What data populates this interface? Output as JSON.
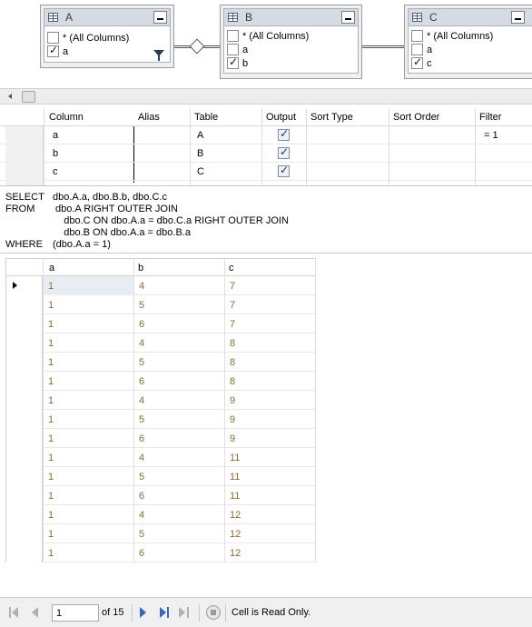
{
  "diagram": {
    "tables": [
      {
        "name": "A",
        "rows": [
          {
            "label": "* (All Columns)",
            "checked": false
          },
          {
            "label": "a",
            "checked": true
          }
        ],
        "has_filter": true
      },
      {
        "name": "B",
        "rows": [
          {
            "label": "* (All Columns)",
            "checked": false
          },
          {
            "label": "a",
            "checked": false
          },
          {
            "label": "b",
            "checked": true
          }
        ]
      },
      {
        "name": "C",
        "rows": [
          {
            "label": "* (All Columns)",
            "checked": false
          },
          {
            "label": "a",
            "checked": false
          },
          {
            "label": "c",
            "checked": true
          }
        ]
      }
    ]
  },
  "criteria": {
    "headers": [
      "Column",
      "Alias",
      "Table",
      "Output",
      "Sort Type",
      "Sort Order",
      "Filter"
    ],
    "rows": [
      {
        "column": "a",
        "alias": "",
        "table": "A",
        "output": true,
        "sort_type": "",
        "sort_order": "",
        "filter": "= 1"
      },
      {
        "column": "b",
        "alias": "",
        "table": "B",
        "output": true,
        "sort_type": "",
        "sort_order": "",
        "filter": ""
      },
      {
        "column": "c",
        "alias": "",
        "table": "C",
        "output": true,
        "sort_type": "",
        "sort_order": "",
        "filter": ""
      }
    ]
  },
  "sql": {
    "lines": [
      {
        "keyword": "SELECT",
        "text": "dbo.A.a, dbo.B.b, dbo.C.c"
      },
      {
        "keyword": "FROM",
        "text": " dbo.A RIGHT OUTER JOIN"
      },
      {
        "keyword": "",
        "text": "    dbo.C ON dbo.A.a = dbo.C.a RIGHT OUTER JOIN"
      },
      {
        "keyword": "",
        "text": "    dbo.B ON dbo.A.a = dbo.B.a"
      },
      {
        "keyword": "WHERE",
        "text": "(dbo.A.a = 1)"
      }
    ]
  },
  "results": {
    "headers": [
      "a",
      "b",
      "c"
    ],
    "rows": [
      [
        "1",
        "4",
        "7"
      ],
      [
        "1",
        "5",
        "7"
      ],
      [
        "1",
        "6",
        "7"
      ],
      [
        "1",
        "4",
        "8"
      ],
      [
        "1",
        "5",
        "8"
      ],
      [
        "1",
        "6",
        "8"
      ],
      [
        "1",
        "4",
        "9"
      ],
      [
        "1",
        "5",
        "9"
      ],
      [
        "1",
        "6",
        "9"
      ],
      [
        "1",
        "4",
        "11"
      ],
      [
        "1",
        "5",
        "11"
      ],
      [
        "1",
        "6",
        "11"
      ],
      [
        "1",
        "4",
        "12"
      ],
      [
        "1",
        "5",
        "12"
      ],
      [
        "1",
        "6",
        "12"
      ]
    ],
    "current_row": 0
  },
  "navbar": {
    "page_value": "1",
    "of_text": "of 15",
    "status": "Cell is Read Only."
  },
  "colors": {
    "result_text": "#8a6a3a",
    "nav_accent": "#3a66b8"
  }
}
